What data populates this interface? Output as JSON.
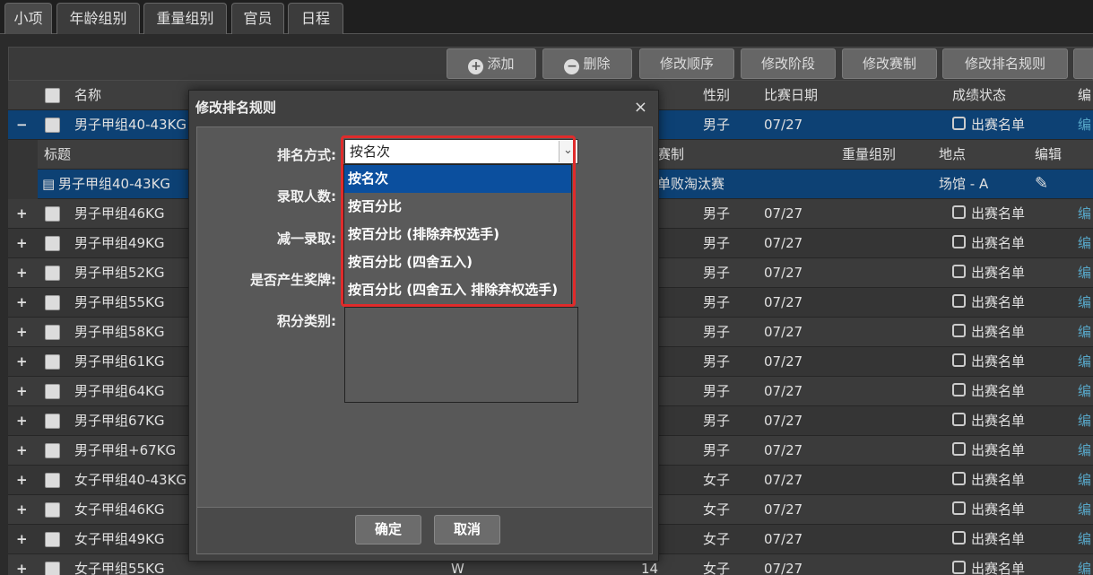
{
  "tabs": [
    "小项",
    "年龄组别",
    "重量组别",
    "官员",
    "日程"
  ],
  "toolbar": {
    "add": "添加",
    "del": "删除",
    "order": "修改顺序",
    "stage": "修改阶段",
    "format": "修改赛制",
    "rank": "修改排名规则"
  },
  "header": {
    "name": "名称",
    "gender": "性别",
    "date": "比赛日期",
    "status": "成绩状态",
    "edit": "编"
  },
  "expanded": {
    "name": "男子甲组40-43KG",
    "gender": "男子",
    "date": "07/27",
    "status": "出赛名单",
    "edit": "编"
  },
  "subheader": {
    "title": "标题",
    "format": "赛制",
    "weight": "重量组别",
    "venue": "地点",
    "edit": "编辑"
  },
  "subrow": {
    "title": "男子甲组40-43KG",
    "format": "单败淘汰赛",
    "venue": "场馆 - A"
  },
  "rows": [
    {
      "name": "男子甲组46KG",
      "gender": "男子",
      "date": "07/27",
      "status": "出赛名单",
      "edit": "编"
    },
    {
      "name": "男子甲组49KG",
      "gender": "男子",
      "date": "07/27",
      "status": "出赛名单",
      "edit": "编"
    },
    {
      "name": "男子甲组52KG",
      "gender": "男子",
      "date": "07/27",
      "status": "出赛名单",
      "edit": "编"
    },
    {
      "name": "男子甲组55KG",
      "gender": "男子",
      "date": "07/27",
      "status": "出赛名单",
      "edit": "编"
    },
    {
      "name": "男子甲组58KG",
      "gender": "男子",
      "date": "07/27",
      "status": "出赛名单",
      "edit": "编"
    },
    {
      "name": "男子甲组61KG",
      "gender": "男子",
      "date": "07/27",
      "status": "出赛名单",
      "edit": "编"
    },
    {
      "name": "男子甲组64KG",
      "gender": "男子",
      "date": "07/27",
      "status": "出赛名单",
      "edit": "编"
    },
    {
      "name": "男子甲组67KG",
      "gender": "男子",
      "date": "07/27",
      "status": "出赛名单",
      "edit": "编"
    },
    {
      "name": "男子甲组+67KG",
      "gender": "男子",
      "date": "07/27",
      "status": "出赛名单",
      "edit": "编"
    },
    {
      "name": "女子甲组40-43KG",
      "gender": "女子",
      "date": "07/27",
      "status": "出赛名单",
      "edit": "编"
    },
    {
      "name": "女子甲组46KG",
      "gender": "女子",
      "date": "07/27",
      "status": "出赛名单",
      "edit": "编"
    },
    {
      "name": "女子甲组49KG",
      "gender": "女子",
      "date": "07/27",
      "status": "出赛名单",
      "edit": "编"
    },
    {
      "name": "女子甲组55KG",
      "gender": "女子",
      "date": "07/27",
      "status": "出赛名单",
      "edit": "编",
      "w": "W",
      "n": "14"
    }
  ],
  "dialog": {
    "title": "修改排名规则",
    "close": "×",
    "labels": [
      "排名方式:",
      "录取人数:",
      "减一录取:",
      "是否产生奖牌:",
      "积分类别:"
    ],
    "selected": "按名次",
    "options": [
      "按名次",
      "按百分比",
      "按百分比 (排除弃权选手)",
      "按百分比 (四舍五入)",
      "按百分比 (四舍五入 排除弃权选手)"
    ],
    "ok": "确定",
    "cancel": "取消"
  }
}
